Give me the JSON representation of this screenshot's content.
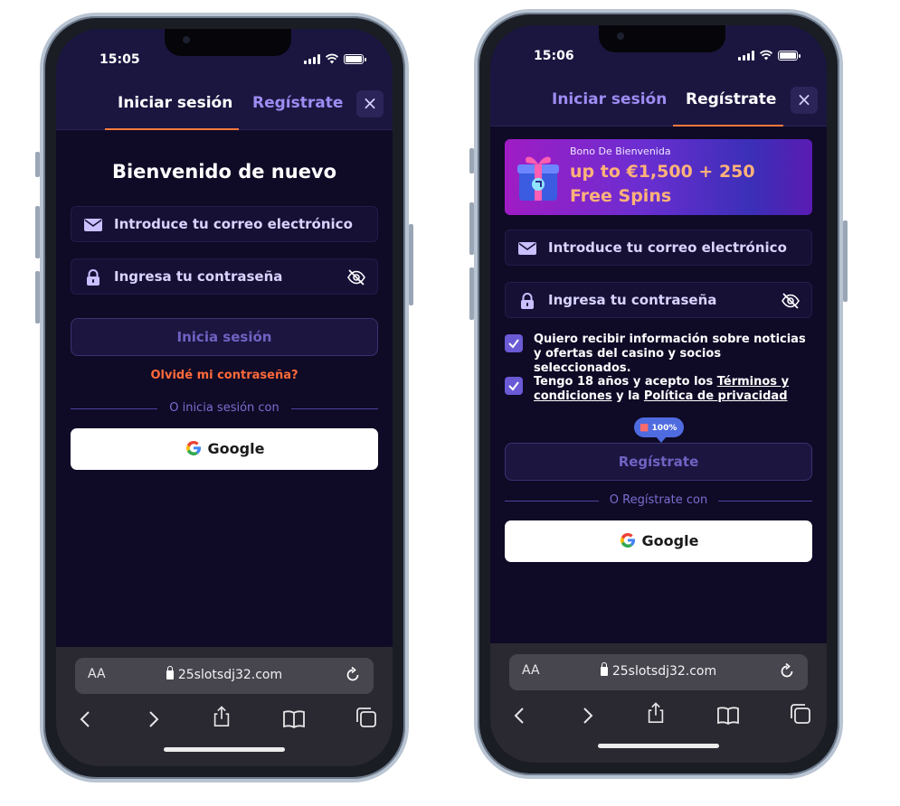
{
  "status": {
    "left_time": "15:05",
    "right_time": "15:06"
  },
  "login": {
    "tab_login": "Iniciar sesión",
    "tab_register": "Regístrate",
    "close": "×",
    "heading": "Bienvenido de nuevo",
    "email_placeholder": "Introduce tu correo electrónico",
    "password_placeholder": "Ingresa tu contraseña",
    "submit": "Inicia sesión",
    "forgot": "Olvidé mi contraseña?",
    "divider": "O inicia sesión con",
    "google": "Google"
  },
  "register": {
    "tab_login": "Iniciar sesión",
    "tab_register": "Regístrate",
    "close": "×",
    "promo_small": "Bono De Bienvenida",
    "promo_big": "up to €1,500 + 250 Free Spins",
    "email_placeholder": "Introduce tu correo electrónico",
    "password_placeholder": "Ingresa tu contraseña",
    "check1": "Quiero recibir información sobre noticias y ofertas del casino y socios seleccionados.",
    "check2_pre": "Tengo 18 años y acepto los ",
    "check2_terms": "Términos y condiciones",
    "check2_mid": " y la ",
    "check2_privacy": "Política de privacidad",
    "badge": "100%",
    "submit": "Regístrate",
    "divider": "O Regístrate con",
    "google": "Google"
  },
  "browser": {
    "aa": "AA",
    "url": "25slotsdj32.com"
  },
  "colors": {
    "background": "#0f0a26",
    "accent_orange": "#ff6a3a",
    "tab_purple": "#9d8cf2",
    "checkbox": "#6b5ad6"
  }
}
